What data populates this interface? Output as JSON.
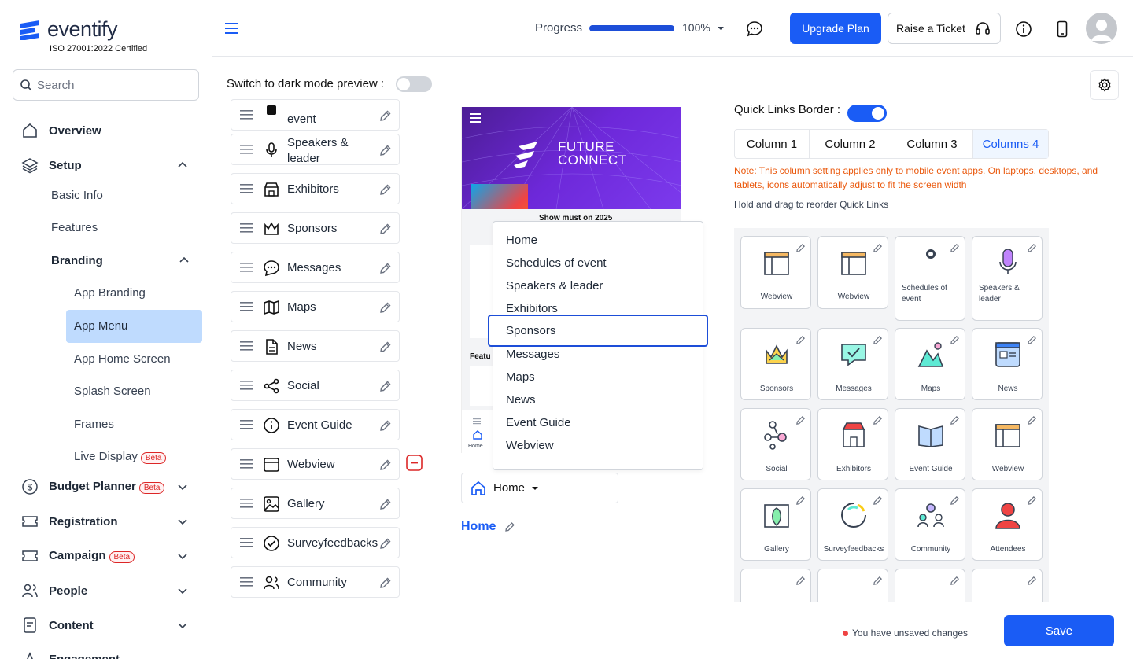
{
  "brand": {
    "name": "eventify",
    "cert": "ISO 27001:2022 Certified"
  },
  "search": {
    "placeholder": "Search"
  },
  "sidebar": {
    "overview": "Overview",
    "setup": "Setup",
    "setup_children": [
      "Basic Info",
      "Features"
    ],
    "branding": "Branding",
    "branding_children": [
      "App Branding",
      "App Menu",
      "App Home Screen",
      "Splash Screen",
      "Frames",
      "Live Display"
    ],
    "beta": "Beta",
    "budget": "Budget Planner",
    "registration": "Registration",
    "campaign": "Campaign",
    "people": "People",
    "content": "Content",
    "engagement": "Engagement"
  },
  "header": {
    "progress_label": "Progress",
    "progress_value": "100%",
    "progress_fraction": 1.0,
    "upgrade": "Upgrade Plan",
    "ticket": "Raise a Ticket"
  },
  "preview_toggle": {
    "label": "Switch to dark mode preview :"
  },
  "menu_items": [
    "event",
    "Speakers &\nleader",
    "Exhibitors",
    "Sponsors",
    "Messages",
    "Maps",
    "News",
    "Social",
    "Event Guide",
    "Webview",
    "Gallery",
    "Surveyfeedbacks",
    "Community"
  ],
  "preview": {
    "hero_title_1": "FUTURE",
    "hero_title_2": "CONNECT",
    "card_title": "Show must on 2025",
    "feature_label": "Featu",
    "tab_home": "Home"
  },
  "dropdown": {
    "options": [
      "Home",
      "Schedules of event",
      "Speakers & leader",
      "Exhibitors",
      "Sponsors",
      "Messages",
      "Maps",
      "News",
      "Event Guide",
      "Webview"
    ],
    "selected": "Sponsors"
  },
  "home_select": {
    "value": "Home"
  },
  "home_link": "Home",
  "quick_links": {
    "border_label": "Quick Links Border :",
    "tabs": [
      "Column 1",
      "Column 2",
      "Column 3",
      "Columns 4"
    ],
    "active_tab": "Columns 4",
    "note": "Note: This column setting applies only to mobile event apps. On laptops, desktops, and tablets, icons automatically adjust to fit the screen width",
    "hold": "Hold and drag to reorder Quick Links",
    "cards": [
      "Webview",
      "Webview",
      "Schedules of\nevent",
      "Speakers &\nleader",
      "Sponsors",
      "Messages",
      "Maps",
      "News",
      "Social",
      "Exhibitors",
      "Event Guide",
      "Webview",
      "Gallery",
      "Surveyfeedbacks",
      "Community",
      "Attendees"
    ]
  },
  "footer": {
    "unsaved": "You have unsaved changes",
    "save": "Save"
  },
  "colors": {
    "accent": "#1a5cf5",
    "active_bg": "#bfdbfe",
    "warning": "#ea580c"
  }
}
